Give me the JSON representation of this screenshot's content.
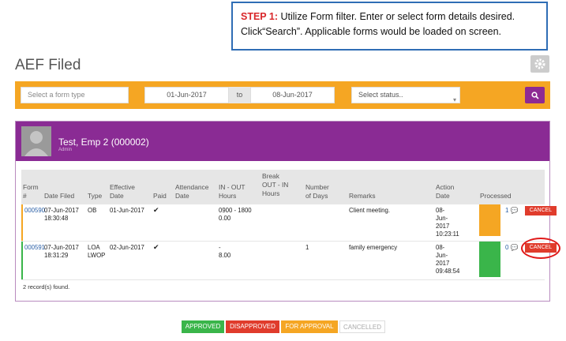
{
  "callout": {
    "step": "STEP 1:",
    "text": "Utilize Form filter. Enter or select form details desired. Click“Search”. Applicable forms would be loaded on screen."
  },
  "page": {
    "title": "AEF Filed"
  },
  "filter": {
    "form_type_placeholder": "Select a form type",
    "date_from": "01-Jun-2017",
    "to_label": "to",
    "date_to": "08-Jun-2017",
    "status_placeholder": "Select status..",
    "icons": {
      "settings": "gear-icon",
      "search": "search-icon",
      "status_caret": "chevron-down-icon"
    }
  },
  "employee": {
    "name": "Test, Emp 2 (000002)",
    "sub": "Admin"
  },
  "table": {
    "headers": {
      "form": "Form\n#",
      "date_filed": "Date Filed",
      "type": "Type",
      "effective": "Effective\nDate",
      "paid": "Paid",
      "attendance": "Attendance\nDate",
      "in_out": "IN - OUT\nHours",
      "break": "Break\nOUT - IN\nHours",
      "days": "Number\nof Days",
      "remarks": "Remarks",
      "action": "Action\nDate",
      "processed": "Processed"
    },
    "rows": [
      {
        "form": "000590",
        "date_filed": "07-Jun-2017\n18:30:48",
        "type": "OB",
        "effective": "01-Jun-2017",
        "paid": "✔",
        "attendance": "",
        "in_out": "0900 - 1800\n0.00",
        "break": "",
        "days": "",
        "remarks": "Client meeting.",
        "action": "08-\nJun-\n2017\n10:23:11",
        "count": "1",
        "cancel": "CANCEL",
        "status_color": "#f5a623"
      },
      {
        "form": "000591",
        "date_filed": "07-Jun-2017\n18:31:29",
        "type": "LOA\nLWOP",
        "effective": "02-Jun-2017",
        "paid": "✔",
        "attendance": "",
        "in_out": "-\n8.00",
        "break": "",
        "days": "1",
        "remarks": "family emergency",
        "action": "08-\nJun-\n2017\n09:48:54",
        "count": "0",
        "cancel": "CANCEL",
        "status_color": "#3ab54a"
      }
    ],
    "footer": "2 record(s) found."
  },
  "legend": [
    {
      "label": "APPROVED",
      "color": "#3ab54a"
    },
    {
      "label": "DISAPPROVED",
      "color": "#e03c2c"
    },
    {
      "label": "FOR APPROVAL",
      "color": "#f5a623"
    },
    {
      "label": "CANCELLED",
      "color": "#ffffff"
    }
  ]
}
